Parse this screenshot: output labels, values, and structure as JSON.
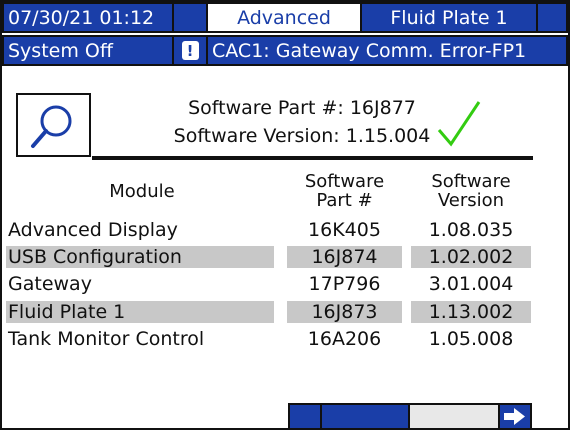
{
  "top_bar": {
    "datetime": "07/30/21 01:12",
    "mode": "Advanced",
    "screen_name": "Fluid Plate 1"
  },
  "status_bar": {
    "system_status": "System Off",
    "alert_icon": "warning-icon",
    "alert_text": "CAC1: Gateway Comm. Error-FP1"
  },
  "software": {
    "part_label": "Software Part #: 16J877",
    "version_label": "Software Version: 1.15.004"
  },
  "table": {
    "headers": {
      "module": "Module",
      "part_line1": "Software",
      "part_line2": "Part #",
      "version_line1": "Software",
      "version_line2": "Version"
    },
    "rows": [
      {
        "module": "Advanced Display",
        "part": "16K405",
        "version": "1.08.035"
      },
      {
        "module": "USB Configuration",
        "part": "16J874",
        "version": "1.02.002"
      },
      {
        "module": "Gateway",
        "part": "17P796",
        "version": "3.01.004"
      },
      {
        "module": "Fluid Plate 1",
        "part": "16J873",
        "version": "1.13.002"
      },
      {
        "module": "Tank Monitor Control",
        "part": "16A206",
        "version": "1.05.008"
      }
    ]
  },
  "softkeys": {
    "next_icon": "arrow-right-icon"
  },
  "colors": {
    "accent": "#1a3ea8",
    "shade": "#c8c8c8",
    "check": "#33cc11"
  }
}
